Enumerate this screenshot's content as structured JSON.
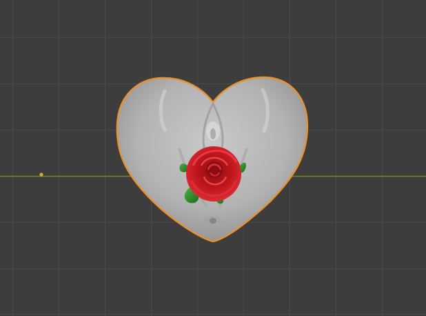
{
  "viewport": {
    "background": "#3d3d3d",
    "grid_color": "#4a4a4a",
    "axis_color": "#6e8b2e",
    "origin_color": "#e8a53a"
  },
  "object": {
    "selection_outline": "#e8912d",
    "mesh_color": "#b5b5b5",
    "decal": "rose-icon",
    "rose_color": "#c0161c",
    "leaf_color": "#2f8a2a"
  }
}
